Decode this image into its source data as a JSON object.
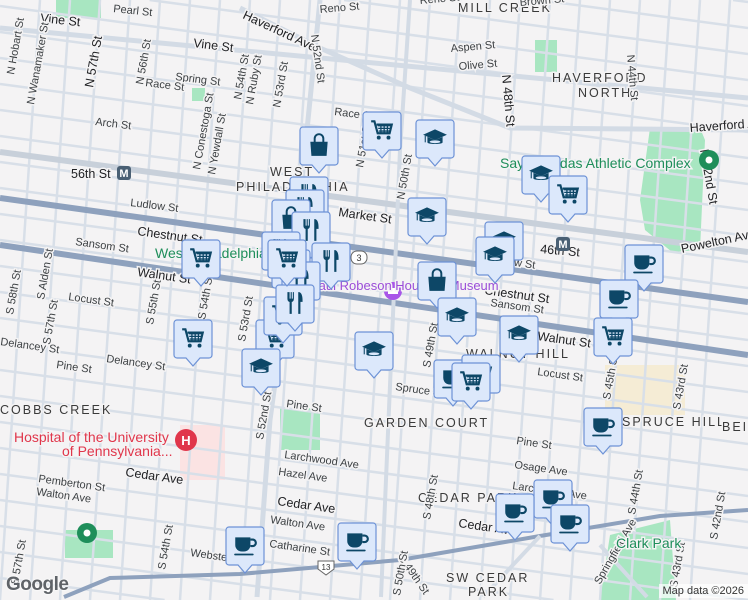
{
  "map": {
    "neighborhoods": [
      "MILL CREEK",
      "HAVERFORD",
      "NORTH",
      "WEST",
      "PHILADELPHIA",
      "WALNUT HILL",
      "GARDEN COURT",
      "SPRUCE HILL",
      "CEDAR PARK",
      "SW CEDAR",
      "PARK",
      "COBBS CREEK",
      "BEI"
    ],
    "streets": [
      "Vine St",
      "Pearl St",
      "Haverford Ave",
      "Vine St",
      "Reno St",
      "Reno St",
      "Brown St",
      "N 52nd St",
      "N Hobart St",
      "N Wanamaker St",
      "N 57th St",
      "N 56th St",
      "Spring St",
      "Race St",
      "N 54th St",
      "N Ruby St",
      "N 53rd St",
      "Race St",
      "N Conestoga St",
      "N Yewdall St",
      "Arch St",
      "56th St",
      "Ludlow St",
      "Market St",
      "Chestnut St",
      "Sansom St",
      "Walnut St",
      "Locust St",
      "Aspen St",
      "Olive St",
      "N 48th St",
      "N 44th St",
      "Haverford Ave",
      "N 42nd St",
      "N 50th St",
      "N 51st St",
      "46th St",
      "Ludlow St",
      "Chestnut St",
      "Powelton Ave",
      "Sansom St",
      "Walnut St",
      "Locust St",
      "S 49th St",
      "S 45th St",
      "S 43rd St",
      "Spruce St",
      "Pine St",
      "Osage Ave",
      "Larchwood Ave",
      "S 48th St",
      "Cedar Ave",
      "S 44th St",
      "S 43rd St",
      "S 42nd St",
      "Springfield Ave",
      "S 49th St",
      "S 58th St",
      "S Alden St",
      "S 57th St",
      "S 55th St",
      "S 54th St",
      "S 53rd St",
      "Delancey St",
      "Delancey St",
      "Pine St",
      "Pine St",
      "S 52nd St",
      "Larchwood Ave",
      "Hazel Ave",
      "Cedar Ave",
      "Cedar Ave",
      "Pemberton St",
      "Walton Ave",
      "Walton Ave",
      "Catharine St",
      "Webster St",
      "S 54th St",
      "S 50th St",
      "S 57th St"
    ],
    "route_shield": "3",
    "route_shield_2": "13",
    "pois": {
      "complex": "Sayre-Gadas Athletic Complex",
      "station_west": "West Philadelphia",
      "museum": "Paul Robeson House & Museum",
      "hospital_1": "Hospital of the University",
      "hospital_2": "of Pennsylvania...",
      "park": "Clark Park"
    },
    "metro_label": "M",
    "google_logo": "Google",
    "attribution": "Map data ©2026",
    "colors": {
      "marker_fill": "#dce8fb",
      "marker_border": "#6d92d6",
      "marker_icon": "#0d4767",
      "arterial": "#8ea1bd",
      "road": "#d6dde6",
      "park": "#a8e6c1"
    }
  },
  "markers": [
    {
      "type": "bag-icon"
    },
    {
      "type": "cart-icon"
    },
    {
      "type": "cap-icon"
    },
    {
      "type": "cap-icon"
    },
    {
      "type": "cap-icon"
    },
    {
      "type": "cart-icon"
    },
    {
      "type": "cap-icon"
    },
    {
      "type": "cap-icon"
    },
    {
      "type": "bag-icon"
    },
    {
      "type": "cap-icon"
    },
    {
      "type": "cap-icon"
    },
    {
      "type": "cup-icon"
    },
    {
      "type": "cup-icon"
    },
    {
      "type": "cart-icon"
    },
    {
      "type": "cart-icon"
    },
    {
      "type": "cart-icon"
    },
    {
      "type": "cart-icon"
    },
    {
      "type": "cart-icon"
    },
    {
      "type": "cap-icon"
    },
    {
      "type": "cap-icon"
    },
    {
      "type": "cup-icon"
    },
    {
      "type": "cart-icon"
    },
    {
      "type": "cart-icon"
    },
    {
      "type": "cup-icon"
    },
    {
      "type": "cup-icon"
    },
    {
      "type": "cup-icon"
    },
    {
      "type": "cup-icon"
    },
    {
      "type": "cup-icon"
    },
    {
      "type": "cup-icon"
    },
    {
      "type": "fork-knife-icon"
    },
    {
      "type": "fork-knife-icon"
    },
    {
      "type": "bag-icon"
    },
    {
      "type": "fork-knife-icon"
    },
    {
      "type": "fork-knife-icon"
    },
    {
      "type": "fork-knife-icon"
    },
    {
      "type": "fork-knife-icon"
    },
    {
      "type": "fork-knife-icon"
    },
    {
      "type": "fork-knife-icon"
    },
    {
      "type": "cart-icon"
    }
  ]
}
